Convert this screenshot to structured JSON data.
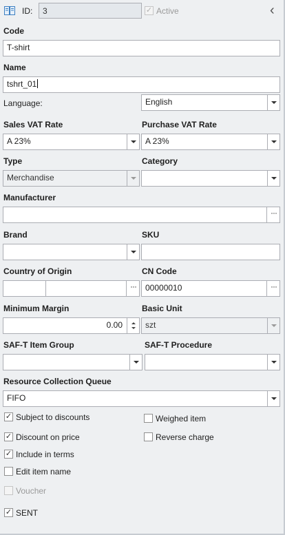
{
  "header": {
    "id_label": "ID:",
    "id_value": "3",
    "active_label": "Active",
    "active_checked": true,
    "collapse_glyph": "‹"
  },
  "code": {
    "label": "Code",
    "value": "T-shirt"
  },
  "name": {
    "label": "Name",
    "value": "tshrt_01"
  },
  "language": {
    "label": "Language:",
    "value": "English"
  },
  "sales_vat": {
    "label": "Sales VAT Rate",
    "value": "A 23%"
  },
  "purchase_vat": {
    "label": "Purchase VAT Rate",
    "value": "A 23%"
  },
  "type": {
    "label": "Type",
    "value": "Merchandise"
  },
  "category": {
    "label": "Category",
    "value": ""
  },
  "manufacturer": {
    "label": "Manufacturer",
    "value": ""
  },
  "brand": {
    "label": "Brand",
    "value": ""
  },
  "sku": {
    "label": "SKU",
    "value": ""
  },
  "country": {
    "label": "Country of Origin",
    "code": "",
    "name": ""
  },
  "cn_code": {
    "label": "CN Code",
    "value": "00000010"
  },
  "min_margin": {
    "label": "Minimum Margin",
    "value": "0.00"
  },
  "basic_unit": {
    "label": "Basic Unit",
    "value": "szt"
  },
  "saft_group": {
    "label": "SAF-T Item Group",
    "value": ""
  },
  "saft_procedure": {
    "label": "SAF-T Procedure",
    "value": ""
  },
  "queue": {
    "label": "Resource Collection Queue",
    "value": "FIFO"
  },
  "checkboxes": {
    "subject_to_discounts": {
      "label": "Subject to discounts",
      "checked": true
    },
    "weighed_item": {
      "label": "Weighed item",
      "checked": false
    },
    "discount_on_price": {
      "label": "Discount on price",
      "checked": true
    },
    "reverse_charge": {
      "label": "Reverse charge",
      "checked": false
    },
    "include_in_terms": {
      "label": "Include in terms",
      "checked": true
    },
    "edit_item_name": {
      "label": "Edit item name",
      "checked": false
    },
    "voucher": {
      "label": "Voucher",
      "checked": false
    },
    "sent": {
      "label": "SENT",
      "checked": true
    }
  },
  "glyphs": {
    "check": "✓",
    "dots": "···"
  },
  "icons": {
    "header": "book-icon"
  },
  "colors": {
    "border": "#abadb3",
    "panel": "#eef0f2",
    "accent": "#3c7fc1"
  }
}
